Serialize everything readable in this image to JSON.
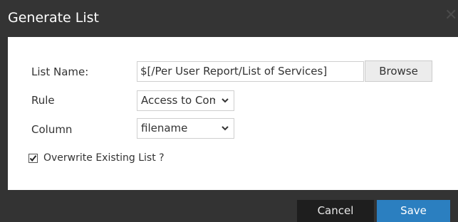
{
  "dialog": {
    "title": "Generate List",
    "close_symbol": "✕"
  },
  "form": {
    "list_name_label": "List Name:",
    "list_name_value": "$[/Per User Report/List of Services]",
    "browse_label": "Browse",
    "rule_label": "Rule",
    "rule_value": "Access to Computer",
    "column_label": "Column",
    "column_value": "filename",
    "overwrite_label": "Overwrite Existing List ?",
    "overwrite_checked": true
  },
  "footer": {
    "cancel_label": "Cancel",
    "save_label": "Save"
  },
  "colors": {
    "titlebar": "#343434",
    "body": "#ffffff",
    "footer": "#333333",
    "save_button": "#2b7fc0",
    "cancel_button": "#1e1e1e"
  },
  "icons": {
    "close": "close-icon",
    "dropdown": "chevron-down-icon",
    "checkbox": "check-icon"
  }
}
